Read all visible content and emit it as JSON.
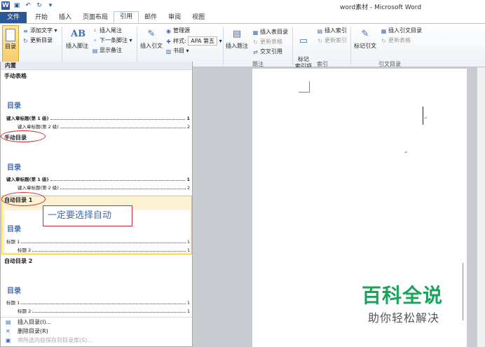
{
  "window": {
    "title": "word素材 - Microsoft Word"
  },
  "tabs": [
    {
      "label": "文件"
    },
    {
      "label": "开始"
    },
    {
      "label": "插入"
    },
    {
      "label": "页面布局"
    },
    {
      "label": "引用"
    },
    {
      "label": "邮件"
    },
    {
      "label": "审阅"
    },
    {
      "label": "视图"
    }
  ],
  "ribbon": {
    "toc": {
      "label": "目录",
      "add_text": "添加文字",
      "update_toc": "更新目录"
    },
    "footnotes": {
      "insert_footnote": "插入脚注",
      "insert_endnote": "插入尾注",
      "next_footnote": "下一条脚注",
      "show_notes": "显示备注",
      "ab_icon": "AB"
    },
    "citations": {
      "insert_citation": "插入引文",
      "manage_sources": "管理源",
      "style_label": "样式:",
      "style_value": "APA 第五",
      "bibliography": "书目"
    },
    "captions": {
      "insert_caption": "插入题注",
      "insert_table_of_figures": "插入表目录",
      "update_table": "更新表格",
      "cross_reference": "交叉引用",
      "group_label": "题注"
    },
    "index": {
      "mark_entry": "标记\n索引项",
      "insert_index": "插入索引",
      "update_index": "更新索引",
      "group_label": "索引"
    },
    "authorities": {
      "mark_citation": "标记引文",
      "insert_table_of_authorities": "插入引文目录",
      "update_table": "更新表格",
      "group_label": "引文目录"
    }
  },
  "panel": {
    "header": "内置",
    "manual_table": {
      "title": "手动表格",
      "toc_heading": "目录",
      "lines": [
        {
          "text": "键入章标题(第 1 级)",
          "page": "1"
        },
        {
          "text": "键入章标题(第 2 级)",
          "page": "2"
        }
      ]
    },
    "manual_toc": {
      "title": "手动目录",
      "toc_heading": "目录",
      "lines": [
        {
          "text": "键入章标题(第 1 级)",
          "page": "1"
        },
        {
          "text": "键入章标题(第 2 级)",
          "page": "2"
        }
      ]
    },
    "auto_toc_1": {
      "title": "自动目录 1",
      "toc_heading": "目录",
      "lines": [
        {
          "text": "标题 1",
          "page": "1"
        },
        {
          "text": "标题 2",
          "page": "1"
        }
      ]
    },
    "auto_toc_2": {
      "title": "自动目录 2",
      "toc_heading": "目录",
      "lines": [
        {
          "text": "标题 1",
          "page": "1"
        },
        {
          "text": "标题 2",
          "page": "1"
        }
      ]
    },
    "annotation_hint": "一定要选择自动",
    "menu": [
      {
        "label": "插入目录(I)...",
        "enabled": true
      },
      {
        "label": "删除目录(R)",
        "enabled": true
      },
      {
        "label": "将所选内容保存到目录库(S)...",
        "enabled": false
      }
    ]
  },
  "watermark": {
    "main": "百科全说",
    "sub": "助你轻松解决"
  },
  "colors": {
    "accent": "#2b5797",
    "highlight_border": "#d42a2a",
    "toc_heading": "#3e6bb8",
    "watermark": "#1aa35a"
  }
}
